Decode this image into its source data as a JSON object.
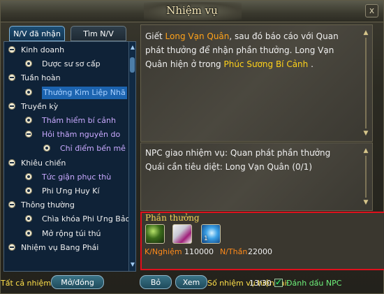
{
  "window": {
    "title": "Nhiệm vụ",
    "close_symbol": "x"
  },
  "tabs": [
    {
      "label": "N/V đã nhận",
      "active": true
    },
    {
      "label": "Tìm N/V",
      "active": false
    }
  ],
  "tree": [
    {
      "type": "category",
      "label": "Kinh doanh"
    },
    {
      "type": "quest",
      "label": "Dược sư sơ cấp",
      "color": "white"
    },
    {
      "type": "category",
      "label": "Tuần hoàn"
    },
    {
      "type": "quest",
      "label": "Thưởng Kim Liệp Nhã",
      "color": "selected"
    },
    {
      "type": "category",
      "label": "Truyền kỳ"
    },
    {
      "type": "quest",
      "label": "Thám hiểm bí cảnh",
      "color": "violet"
    },
    {
      "type": "subcategory",
      "label": "Hỏi thăm nguyên do",
      "color": "violet"
    },
    {
      "type": "subquest",
      "label": "Chỉ điểm bến mê",
      "color": "violet"
    },
    {
      "type": "category",
      "label": "Khiêu chiến"
    },
    {
      "type": "quest",
      "label": "Tức giận phục thù",
      "color": "violet"
    },
    {
      "type": "quest",
      "label": "Phi Ưng Huy Kí",
      "color": "white"
    },
    {
      "type": "category",
      "label": "Thông thường"
    },
    {
      "type": "quest",
      "label": "Chìa khóa Phi Ưng Bảo",
      "color": "white"
    },
    {
      "type": "quest",
      "label": "Mở rộng túi thú",
      "color": "white"
    },
    {
      "type": "category",
      "label": "Nhiệm vụ Bang Phái"
    }
  ],
  "description": {
    "part1": "Giết ",
    "target": "Long Vạn Quân",
    "part2": ", sau đó báo cáo với Quan phát thưởng để nhận phần thưởng. Long Vạn Quân hiện ở trong ",
    "location": "Phúc Sương Bí Cảnh",
    "part3": " ."
  },
  "npc": {
    "giver": "NPC giao nhiệm vụ: Quan phát phần thưởng",
    "monster": "Quái cần tiêu diệt: Long Vạn Quân (0/1)"
  },
  "reward": {
    "title": "Phần thưởng",
    "items": [
      {
        "icon": "green-orb-icon",
        "qty": ""
      },
      {
        "icon": "scroll-icon",
        "qty": ""
      },
      {
        "icon": "blue-crystal-icon",
        "qty": "1"
      }
    ],
    "exp_label": "K/Nghiệm",
    "exp_value": "110000",
    "spirit_label": "N/Thần",
    "spirit_value": "22000"
  },
  "bottom": {
    "all_quests_label": "Tất cả nhiệm vụ",
    "open_close": "Mở/đóng",
    "abandon": "Bỏ",
    "view": "Xem",
    "count_label": "Số nhiệm vụ hiện tại",
    "count_value": "13/30",
    "mark_label": "Đánh dấu NPC",
    "mark_checked": true
  }
}
